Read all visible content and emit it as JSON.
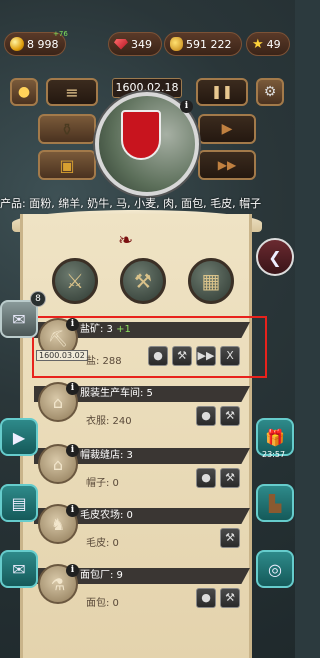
{
  "resources": {
    "gold": "8 998",
    "gold_gain": "+76",
    "rubies": "349",
    "money": "591 222",
    "stars": "49"
  },
  "date_top": "1600.02.18",
  "products_line": "产品: 面粉, 绵羊, 奶牛, 马, 小麦, 肉, 面包, 毛皮, 帽子",
  "notifications": {
    "scroll_badge": "8",
    "gift_timer": "23:57"
  },
  "buildings": [
    {
      "title": "盐矿: 3",
      "gain": "+1",
      "good": "盐: 288",
      "date": "1600.03.02",
      "icon": "mine-icon"
    },
    {
      "title": "服装生产车间: 5",
      "good": "衣服: 240",
      "icon": "workshop-icon"
    },
    {
      "title": "帽裁缝店: 3",
      "good": "帽子: 0",
      "icon": "hat-shop-icon"
    },
    {
      "title": "毛皮农场: 0",
      "good": "毛皮: 0",
      "icon": "fur-farm-icon"
    },
    {
      "title": "面包厂: 9",
      "good": "面包: 0",
      "icon": "bakery-icon"
    }
  ],
  "colors": {
    "highlight": "#e8221c",
    "side_button": "#1f7373"
  }
}
